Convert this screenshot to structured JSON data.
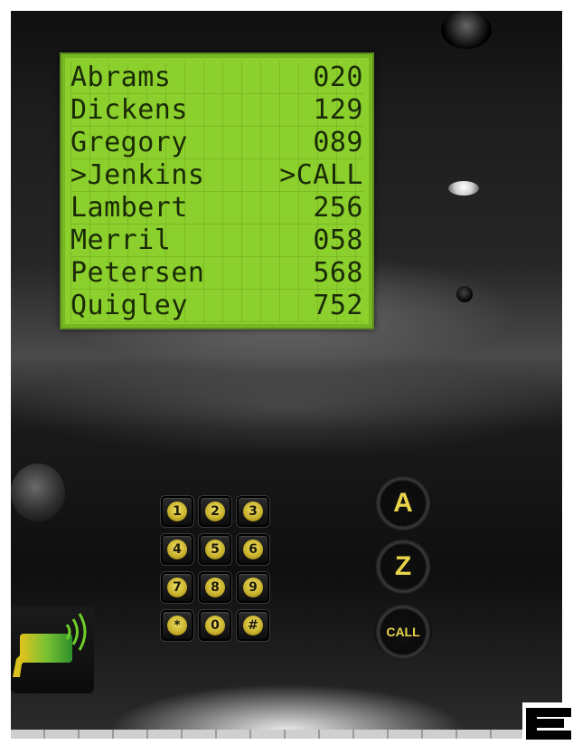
{
  "lcd": {
    "rows": [
      {
        "name": "Abrams",
        "code": "020"
      },
      {
        "name": "Dickens",
        "code": "129"
      },
      {
        "name": "Gregory",
        "code": "089"
      },
      {
        "name": ">Jenkins",
        "code": ">CALL"
      },
      {
        "name": "Lambert",
        "code": "256"
      },
      {
        "name": "Merril",
        "code": "058"
      },
      {
        "name": "Petersen",
        "code": "568"
      },
      {
        "name": "Quigley",
        "code": "752"
      }
    ],
    "color": "#8bd02c"
  },
  "keypad": {
    "keys": [
      "1",
      "2",
      "3",
      "4",
      "5",
      "6",
      "7",
      "8",
      "9",
      "*",
      "0",
      "#"
    ]
  },
  "buttons": {
    "a_label": "A",
    "z_label": "Z",
    "call_label": "CALL",
    "accent_color": "#e9d44a"
  },
  "icons": {
    "rfid": "rfid-card-reader-icon"
  }
}
